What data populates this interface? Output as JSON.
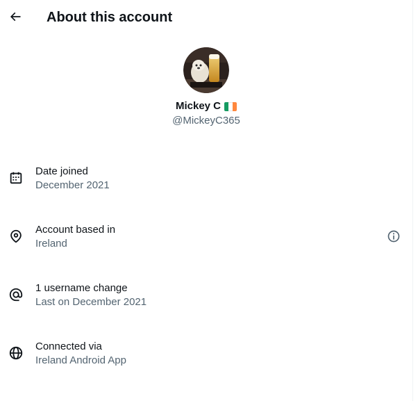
{
  "header": {
    "title": "About this account",
    "back_icon": "arrow-left-icon"
  },
  "profile": {
    "display_name": "Mickey C",
    "flag": "ireland-flag",
    "handle": "@MickeyC365"
  },
  "details": [
    {
      "icon": "calendar-icon",
      "label": "Date joined",
      "value": "December 2021"
    },
    {
      "icon": "location-pin-icon",
      "label": "Account based in",
      "value": "Ireland",
      "info_icon": "info-circle-icon"
    },
    {
      "icon": "at-sign-icon",
      "label": "1 username change",
      "value": "Last on December 2021"
    },
    {
      "icon": "globe-icon",
      "label": "Connected via",
      "value": "Ireland Android App"
    }
  ],
  "colors": {
    "primary_text": "#0f1419",
    "secondary_text": "#536471",
    "flag_green": "#169b62",
    "flag_white": "#ffffff",
    "flag_orange": "#ff883e"
  }
}
